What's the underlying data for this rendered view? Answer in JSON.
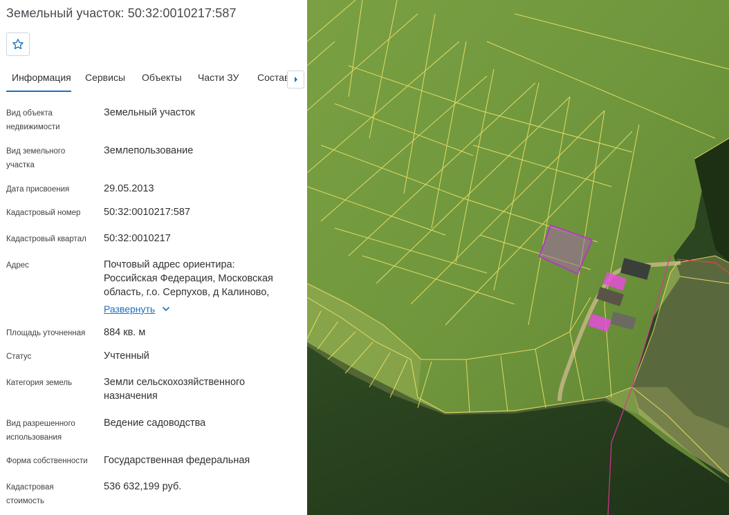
{
  "header": {
    "title": "Земельный участок: 50:32:0010217:587",
    "favorite_icon": "star-outline-icon"
  },
  "tabs": [
    {
      "label": "Информация"
    },
    {
      "label": "Сервисы"
    },
    {
      "label": "Объекты"
    },
    {
      "label": "Части ЗУ"
    },
    {
      "label": "Состав"
    }
  ],
  "fields": [
    {
      "label_1": "Вид объекта",
      "label_2": "недвижимости",
      "value": "Земельный участок"
    },
    {
      "label_1": "Вид земельного",
      "label_2": "участка",
      "value": "Землепользование"
    },
    {
      "label_1": "Дата присвоения",
      "value": "29.05.2013"
    },
    {
      "label_1": "Кадастровый номер",
      "value": "50:32:0010217:587"
    },
    {
      "label_1": "Кадастровый квартал",
      "value": "50:32:0010217"
    },
    {
      "label_1": "Адрес",
      "value_1": "Почтовый адрес ориентира:",
      "value_2": "Российская Федерация, Московская",
      "value_3": "область, г.о. Серпухов, д Калиново,",
      "expand_label": "Развернуть"
    },
    {
      "label_1": "Площадь уточненная",
      "value": "884 кв. м"
    },
    {
      "label_1": "Статус",
      "value": "Учтенный"
    },
    {
      "label_1": "Категория земель",
      "value_1": "Земли сельскохозяйственного",
      "value_2": "назначения"
    },
    {
      "label_1": "Вид разрешенного",
      "label_2": "использования",
      "value": "Ведение садоводства"
    },
    {
      "label_1": "Форма собственности",
      "value": "Государственная федеральная"
    },
    {
      "label_1": "Кадастровая",
      "label_2": "стоимость",
      "value": "536 632,199 руб."
    }
  ],
  "colors": {
    "accent": "#1a6fbf",
    "parcel_border": "#f3ea6a",
    "selected_parcel": "#a43cb8",
    "building": "#e34fd8"
  }
}
